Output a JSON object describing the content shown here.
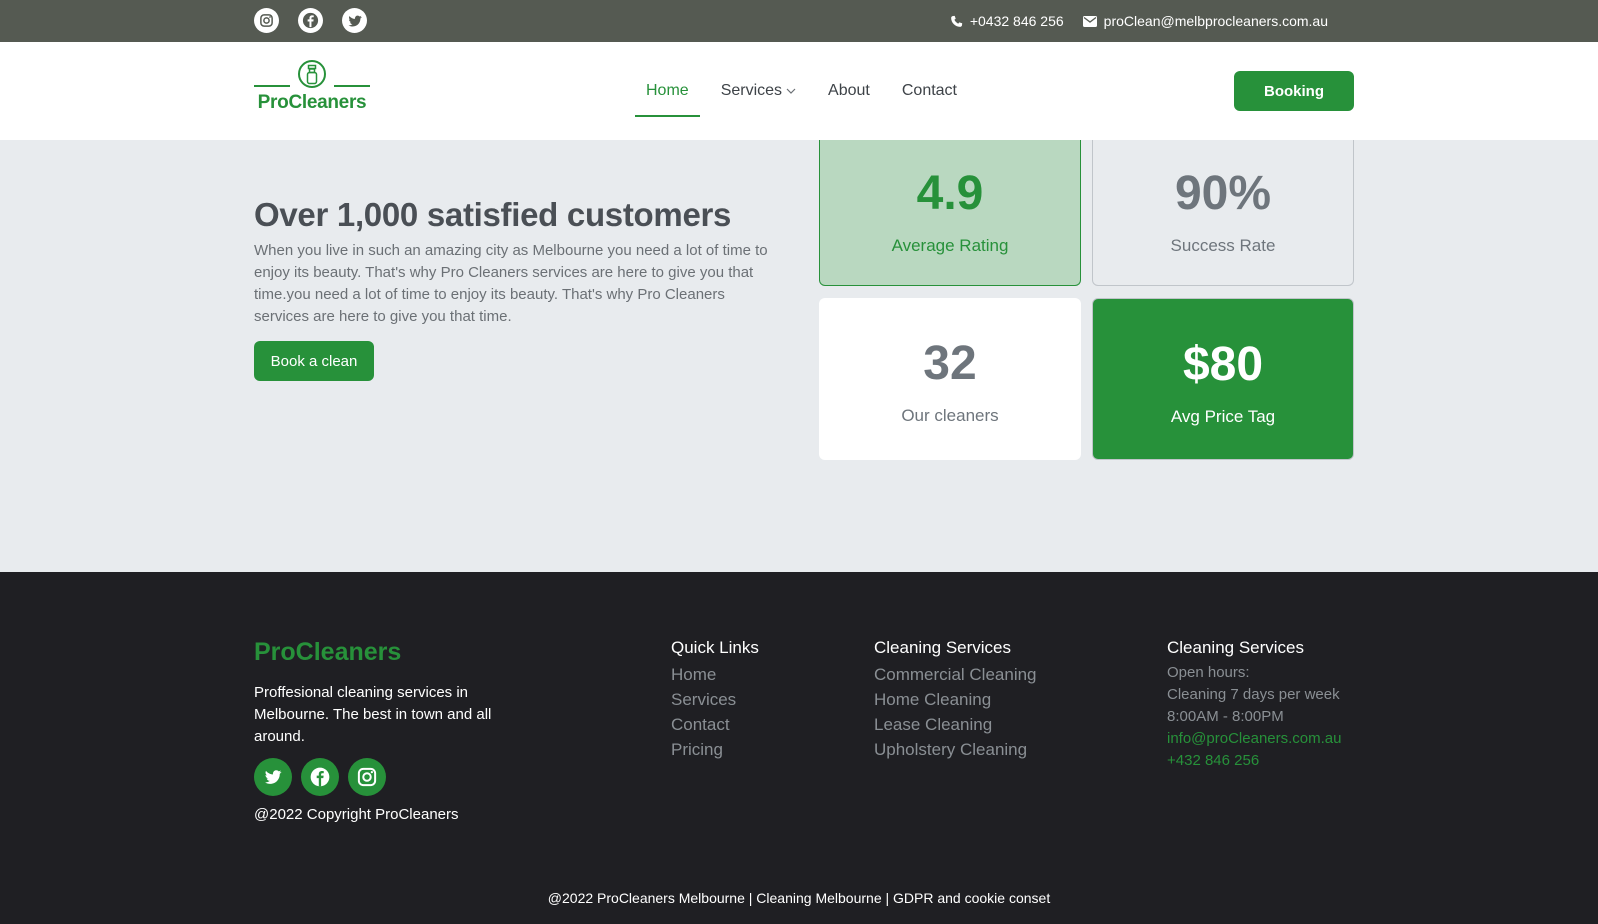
{
  "topbar": {
    "social": [
      "instagram-icon",
      "facebook-icon",
      "twitter-icon"
    ],
    "phone": "+0432 846 256",
    "email": "proClean@melbprocleaners.com.au"
  },
  "header": {
    "logo_text": "ProCleaners",
    "nav": [
      {
        "label": "Home",
        "active": true
      },
      {
        "label": "Services",
        "dropdown": true
      },
      {
        "label": "About"
      },
      {
        "label": "Contact"
      }
    ],
    "booking_label": "Booking"
  },
  "hero": {
    "title": "Over 1,000 satisfied customers",
    "description": "When you live in such an amazing city as Melbourne you need a lot of time to enjoy its beauty. That's why Pro Cleaners services are here to give you that time.you need a lot of time to enjoy its beauty. That's why Pro Cleaners services are here to give you that time.",
    "cta_label": "Book a clean"
  },
  "stats": [
    {
      "value": "4.9",
      "label": "Average Rating"
    },
    {
      "value": "90%",
      "label": "Success Rate"
    },
    {
      "value": "32",
      "label": "Our cleaners"
    },
    {
      "value": "$80",
      "label": "Avg Price Tag"
    }
  ],
  "footer": {
    "brand": "ProCleaners",
    "tagline": "Proffesional cleaning services in Melbourne. The best in town and all around.",
    "social": [
      "twitter-icon",
      "facebook-icon",
      "instagram-icon"
    ],
    "copyright": "@2022 Copyright ProCleaners",
    "quick_links": {
      "title": "Quick Links",
      "items": [
        "Home",
        "Services",
        "Contact",
        "Pricing"
      ]
    },
    "services": {
      "title": "Cleaning Services",
      "items": [
        "Commercial Cleaning",
        "Home Cleaning",
        "Lease Cleaning",
        "Upholstery Cleaning"
      ]
    },
    "info": {
      "title": "Cleaning Services",
      "hours_label": "Open hours:",
      "days": "Cleaning 7 days per week",
      "times": "8:00AM - 8:00PM",
      "email": "info@proCleaners.com.au",
      "phone": "+432 846 256"
    },
    "bottom": "@2022 ProCleaners Melbourne | Cleaning Melbourne | GDPR and cookie conset"
  },
  "colors": {
    "brand_green": "#27913a",
    "topbar": "#555a52",
    "footer_bg": "#1f1f23",
    "page_bg": "#e8ebee"
  }
}
